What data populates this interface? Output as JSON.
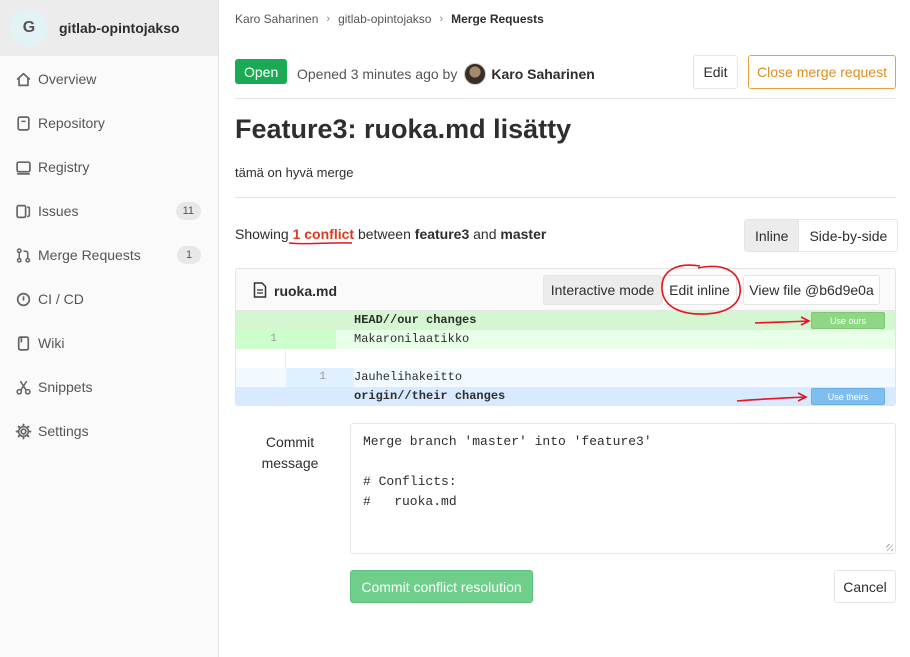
{
  "sidebar": {
    "project_initial": "G",
    "project_name": "gitlab-opintojakso",
    "items": [
      {
        "label": "Overview",
        "icon": "home-icon"
      },
      {
        "label": "Repository",
        "icon": "book-icon"
      },
      {
        "label": "Registry",
        "icon": "container-icon"
      },
      {
        "label": "Issues",
        "icon": "issues-icon",
        "badge": "11"
      },
      {
        "label": "Merge Requests",
        "icon": "merge-request-icon",
        "badge": "1"
      },
      {
        "label": "CI / CD",
        "icon": "rocket-icon"
      },
      {
        "label": "Wiki",
        "icon": "book-icon"
      },
      {
        "label": "Snippets",
        "icon": "scissors-icon"
      },
      {
        "label": "Settings",
        "icon": "gear-icon"
      }
    ]
  },
  "breadcrumb": {
    "items": [
      "Karo Saharinen",
      "gitlab-opintojakso",
      "Merge Requests"
    ],
    "separator": "›"
  },
  "mr": {
    "status": "Open",
    "opened_text": "Opened 3 minutes ago by",
    "author": "Karo Saharinen",
    "edit_label": "Edit",
    "close_label": "Close merge request",
    "title": "Feature3: ruoka.md lisätty",
    "description": "tämä on hyvä merge"
  },
  "conflicts": {
    "showing": "Showing",
    "count_text": "1 conflict",
    "between": "between",
    "source": "feature3",
    "and": "and",
    "target": "master",
    "view_inline": "Inline",
    "view_side": "Side-by-side"
  },
  "file": {
    "name": "ruoka.md",
    "mode_interactive": "Interactive mode",
    "mode_inline": "Edit inline",
    "view_file": "View file @b6d9e0a",
    "head_label": "HEAD//our changes",
    "ours_num": "1",
    "ours_line": "Makaronilaatikko",
    "theirs_num": "1",
    "theirs_line": "Jauhelihakeitto",
    "theirs_label": "origin//their changes",
    "use_ours": "Use ours",
    "use_theirs": "Use theirs"
  },
  "commit": {
    "label": "Commit message",
    "message": "Merge branch 'master' into 'feature3'\n\n# Conflicts:\n#   ruoka.md",
    "submit": "Commit conflict resolution",
    "cancel": "Cancel"
  },
  "colors": {
    "open_badge": "#1aaa55",
    "conflict_red": "#db3b21",
    "close_orange": "#db8e1c",
    "ours_bg": "#e6ffe6",
    "theirs_bg": "#f2f9ff",
    "annotation_red": "#e8141e"
  }
}
